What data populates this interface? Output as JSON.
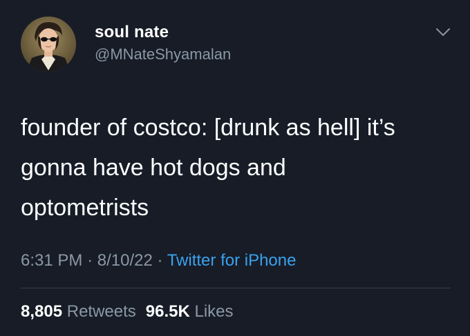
{
  "user": {
    "display_name": "soul nate",
    "handle": "@MNateShyamalan"
  },
  "tweet": {
    "text_line_1": "founder of costco: [drunk as hell] it’s",
    "text_line_2": "gonna have hot dogs and",
    "text_line_3": "optometrists"
  },
  "meta": {
    "time": "6:31 PM",
    "separator": "·",
    "date": "8/10/22",
    "source": "Twitter for iPhone"
  },
  "stats": {
    "retweets_count": "8,805",
    "retweets_label": "Retweets",
    "likes_count": "96.5K",
    "likes_label": "Likes"
  },
  "icons": {
    "menu": "chevron-down-icon"
  },
  "colors": {
    "background": "#171c27",
    "primary_text": "#ffffff",
    "secondary_text": "#8b98a5",
    "link": "#3ba2ec"
  }
}
